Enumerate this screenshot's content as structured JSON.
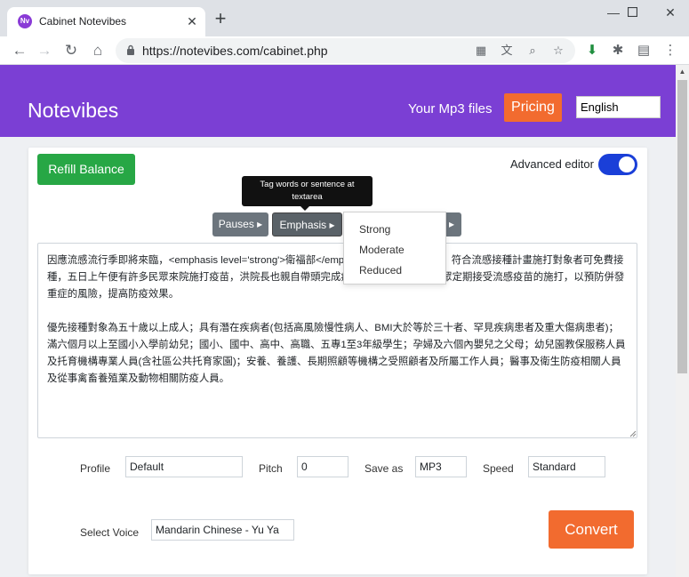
{
  "browser": {
    "tab_title": "Cabinet Notevibes",
    "favicon_text": "Nv",
    "new_tab": "+",
    "url": "https://notevibes.com/cabinet.php"
  },
  "header": {
    "brand": "Notevibes",
    "nav_link": "Your Mp3 files",
    "pricing": "Pricing",
    "language": "English"
  },
  "editor": {
    "refill_button": "Refill Balance",
    "advanced_label": "Advanced editor",
    "advanced_enabled": true,
    "tooltip_line1": "Tag words or sentence at",
    "tooltip_line2": "textarea",
    "tag_buttons": [
      "Pauses ▸",
      "Emphasis ▸",
      "▸"
    ],
    "emphasis_options": [
      "Strong",
      "Moderate",
      "Reduced"
    ],
    "text_para1": "因應流感流行季即將來臨，<emphasis level='strong'>衛福部</emphasis>(五)日全面開打，符合流感接種計畫施打對象者可免費接種，五日上午便有許多民眾來院施打疫苗，洪院長也親自帶頭完成疫苗之接種，他鼓勵民眾定期接受流感疫苗的施打，以預防併發重症的風險，提高防疫效果。",
    "text_para2": "優先接種對象為五十歲以上成人；具有潛在疾病者(包括高風險慢性病人、BMI大於等於三十者、罕見疾病患者及重大傷病患者)；滿六個月以上至國小入學前幼兒；國小、國中、高中、高職、五專1至3年級學生；孕婦及六個內嬰兒之父母；幼兒園教保服務人員及托育機構專業人員(含社區公共托育家園)；安養、養護、長期照顧等機構之受照顧者及所屬工作人員；醫事及衛生防疫相關人員及從事禽畜養殖業及動物相關防疫人員。"
  },
  "form": {
    "profile_label": "Profile",
    "profile_value": "Default",
    "pitch_label": "Pitch",
    "pitch_value": "0",
    "saveas_label": "Save as",
    "saveas_value": "MP3",
    "speed_label": "Speed",
    "speed_value": "Standard",
    "voice_label": "Select Voice",
    "voice_value": "Mandarin Chinese - Yu Ya",
    "convert_button": "Convert"
  },
  "colors": {
    "header": "#7b3fd4",
    "accent_orange": "#f26b2f",
    "refill_green": "#27a745",
    "toggle_blue": "#1a3fd8"
  }
}
